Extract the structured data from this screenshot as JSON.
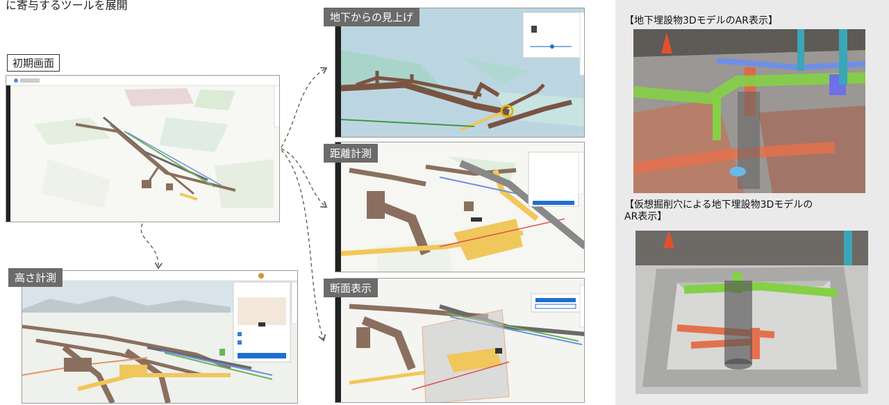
{
  "top_caption": "に寄与するツールを展開",
  "labels": {
    "initial": "初期画面",
    "height": "高さ計測",
    "look_up": "地下からの見上げ",
    "distance": "距離計測",
    "section": "断面表示"
  },
  "right_panel": {
    "caption_1": "【地下埋設物3DモデルのAR表示】",
    "caption_2_line1": "【仮想掘削穴による地下埋設物3Dモデルの",
    "caption_2_line2": "AR表示】"
  },
  "colors": {
    "pipe_brown": "#8b6f5e",
    "pipe_orange": "#e4955f",
    "pipe_yellow": "#f0c75a",
    "pipe_green": "#8fd24f",
    "pipe_blue": "#6f8fe6",
    "panel_grey": "#eaeaea"
  }
}
